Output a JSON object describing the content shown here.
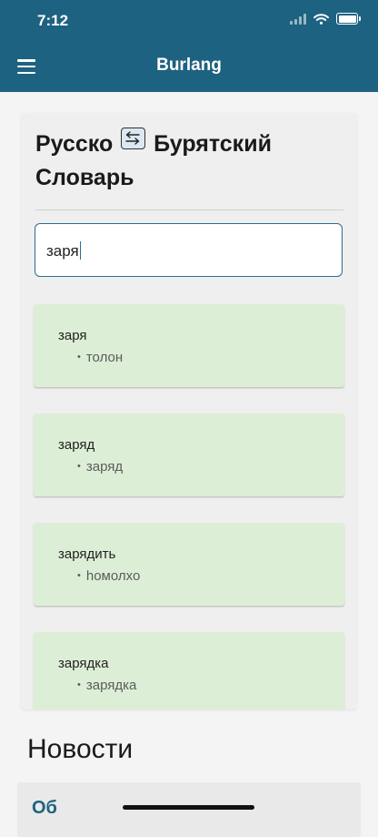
{
  "status_bar": {
    "time": "7:12"
  },
  "app": {
    "title": "Burlang"
  },
  "dictionary": {
    "title_left": "Русско",
    "title_right": "Бурятский",
    "title_line2": "Словарь",
    "search_value": "заря",
    "results": [
      {
        "word": "заря",
        "translation": "толон"
      },
      {
        "word": "заряд",
        "translation": "заряд"
      },
      {
        "word": "зарядить",
        "translation": "һомолхо"
      },
      {
        "word": "зарядка",
        "translation": "зарядка"
      }
    ]
  },
  "news": {
    "heading": "Новости",
    "first_item_peek": "Об"
  },
  "icons": {
    "menu": "hamburger-menu-icon",
    "swap": "swap-arrows-icon",
    "signal": "cellular-signal-icon",
    "wifi": "wifi-icon",
    "battery": "battery-icon"
  },
  "colors": {
    "header": "#1d6280",
    "accent": "#2a6d8f",
    "result_bg": "#ddeed6",
    "background": "#f4f4f4"
  }
}
